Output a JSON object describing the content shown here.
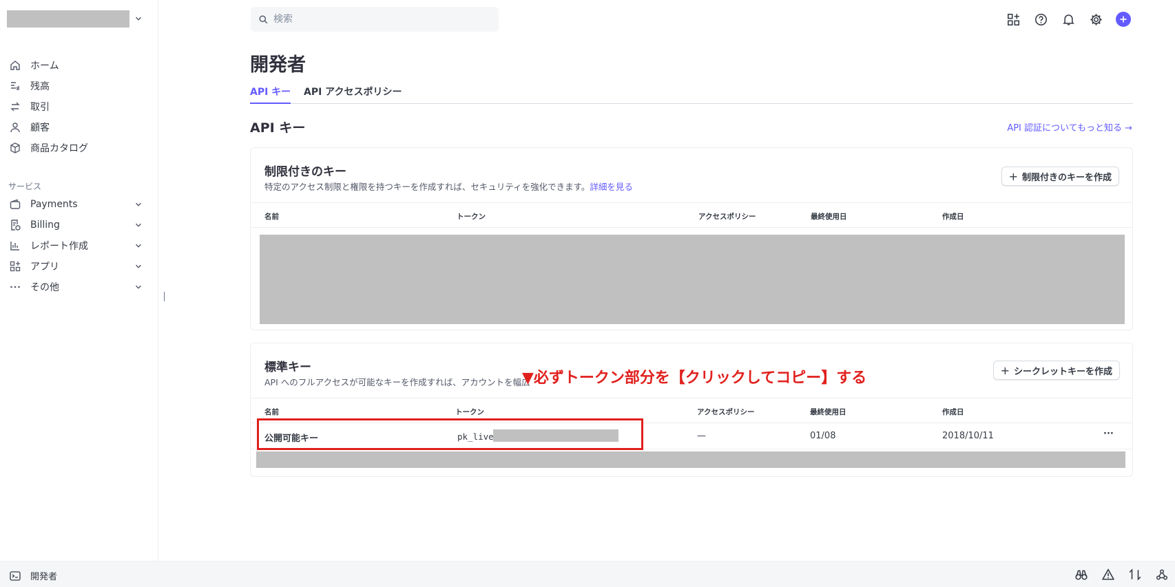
{
  "sidebar": {
    "nav": [
      {
        "label": "ホーム",
        "icon": "home-icon"
      },
      {
        "label": "残高",
        "icon": "balance-icon"
      },
      {
        "label": "取引",
        "icon": "transactions-icon"
      },
      {
        "label": "顧客",
        "icon": "customer-icon"
      },
      {
        "label": "商品カタログ",
        "icon": "product-catalog-icon"
      }
    ],
    "section_label": "サービス",
    "services": [
      {
        "label": "Payments",
        "icon": "wallet-icon"
      },
      {
        "label": "Billing",
        "icon": "billing-icon"
      },
      {
        "label": "レポート作成",
        "icon": "reports-icon"
      },
      {
        "label": "アプリ",
        "icon": "apps-icon"
      },
      {
        "label": "その他",
        "icon": "more-icon"
      }
    ]
  },
  "search": {
    "placeholder": "検索"
  },
  "page": {
    "title": "開発者",
    "tabs": [
      "API キー",
      "API アクセスポリシー"
    ],
    "section_title": "API キー",
    "learn_link": "API 認証についてもっと知る →"
  },
  "restricted_card": {
    "title": "制限付きのキー",
    "description": "特定のアクセス制限と権限を持つキーを作成すれば、セキュリティを強化できます。",
    "description_link": "詳細を見る",
    "button": "制限付きのキーを作成",
    "columns": [
      "名前",
      "トークン",
      "アクセスポリシー",
      "最終使用日",
      "作成日"
    ]
  },
  "standard_card": {
    "title": "標準キー",
    "description": "API へのフルアクセスが可能なキーを作成すれば、アカウントを幅広",
    "button": "シークレットキーを作成",
    "columns": [
      "名前",
      "トークン",
      "アクセスポリシー",
      "最終使用日",
      "作成日"
    ],
    "rows": [
      {
        "name": "公開可能キー",
        "token": "pk_live",
        "policy": "—",
        "last_used": "01/08",
        "created": "2018/10/11",
        "menu": "···"
      }
    ]
  },
  "annotation": "▼必ずトークン部分を【クリックしてコピー】する",
  "bottombar": {
    "label": "開発者"
  },
  "colors": {
    "accent": "#635bff",
    "annotation": "#e0201d",
    "redacted": "#c0c0c0"
  }
}
